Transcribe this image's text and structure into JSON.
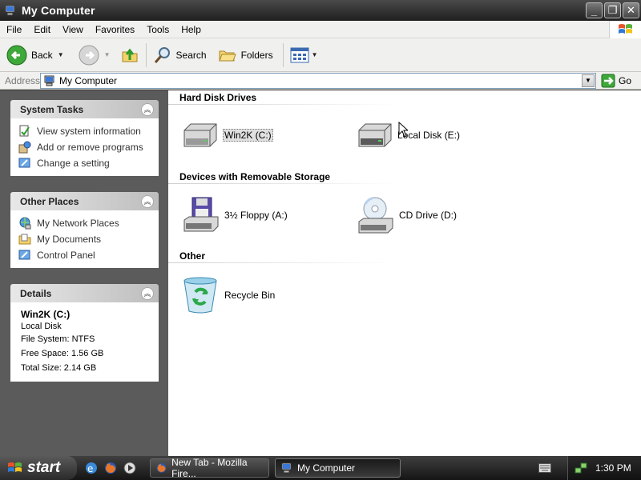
{
  "window": {
    "title": "My Computer"
  },
  "menu": [
    "File",
    "Edit",
    "View",
    "Favorites",
    "Tools",
    "Help"
  ],
  "toolbar": {
    "back": "Back",
    "search": "Search",
    "folders": "Folders"
  },
  "address": {
    "label": "Address",
    "value": "My Computer",
    "go": "Go"
  },
  "sidebar": {
    "system_tasks": {
      "title": "System Tasks",
      "items": [
        "View system information",
        "Add or remove programs",
        "Change a setting"
      ]
    },
    "other_places": {
      "title": "Other Places",
      "items": [
        "My Network Places",
        "My Documents",
        "Control Panel"
      ]
    },
    "details": {
      "title": "Details",
      "name": "Win2K (C:)",
      "type": "Local Disk",
      "file_system": "File System: NTFS",
      "free_space": "Free Space: 1.56 GB",
      "total_size": "Total Size: 2.14 GB"
    }
  },
  "content": {
    "hard_disk": {
      "title": "Hard Disk Drives",
      "items": [
        "Win2K (C:)",
        "Local Disk (E:)"
      ]
    },
    "removable": {
      "title": "Devices with Removable Storage",
      "items": [
        "3½ Floppy (A:)",
        "CD Drive (D:)"
      ]
    },
    "other": {
      "title": "Other",
      "items": [
        "Recycle Bin"
      ]
    }
  },
  "taskbar": {
    "start": "start",
    "tasks": [
      "New Tab - Mozilla Fire...",
      "My Computer"
    ],
    "clock": "1:30 PM"
  }
}
